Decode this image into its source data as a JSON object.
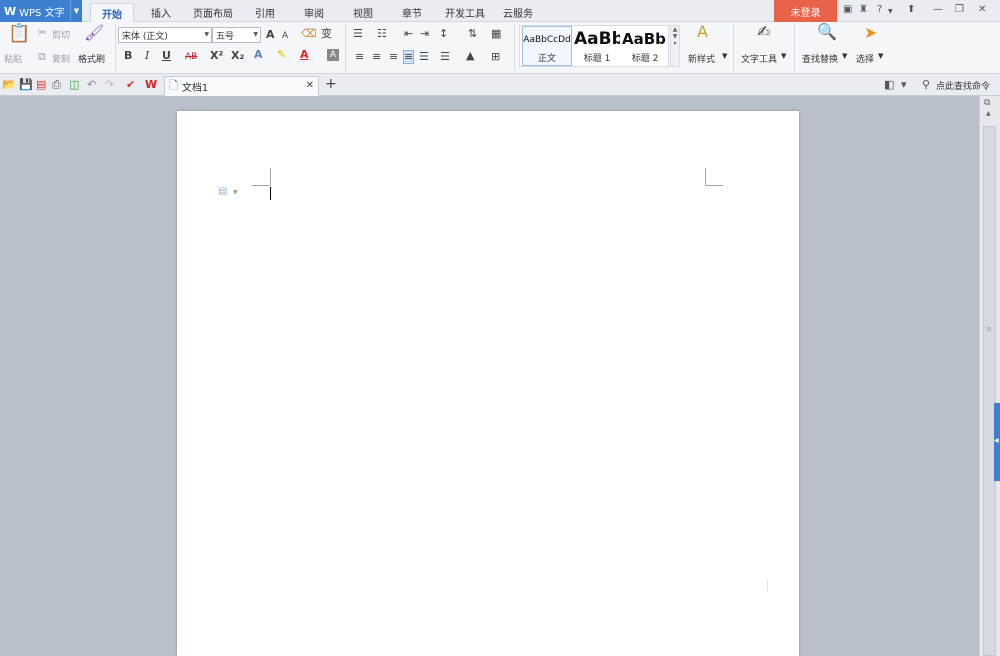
{
  "app": {
    "brand": "WPS 文字",
    "login": "未登录"
  },
  "tabs": [
    "开始",
    "插入",
    "页面布局",
    "引用",
    "审阅",
    "视图",
    "章节",
    "开发工具",
    "云服务"
  ],
  "window_controls": {
    "help": "?"
  },
  "ribbon": {
    "clipboard": {
      "paste": "粘贴",
      "cut": "剪切",
      "copy": "复制",
      "format_painter": "格式刷"
    },
    "font": {
      "family": "宋体 (正文)",
      "size": "五号",
      "bold": "B",
      "italic": "I",
      "underline": "U",
      "strike": "AB",
      "superscript": "X²",
      "subscript": "X₂",
      "grow": "A",
      "shrink": "A",
      "change_case": "变"
    },
    "styles": {
      "normal_sample": "AaBbCcDd",
      "normal_label": "正文",
      "h1_sample": "AaBb",
      "h1_label": "标题 1",
      "h2_sample": "AaBb",
      "h2_label": "标题 2",
      "new_style": "新样式"
    },
    "text_tools": "文字工具",
    "find_replace": "查找替换",
    "select": "选择"
  },
  "quickbar": {
    "doc_tab": "文档1",
    "command_search": "点此查找命令",
    "new_tab": "+"
  },
  "colors": {
    "brand_blue": "#3d7fd1",
    "login_red": "#e9624a",
    "workspace": "#b9c0cb"
  }
}
